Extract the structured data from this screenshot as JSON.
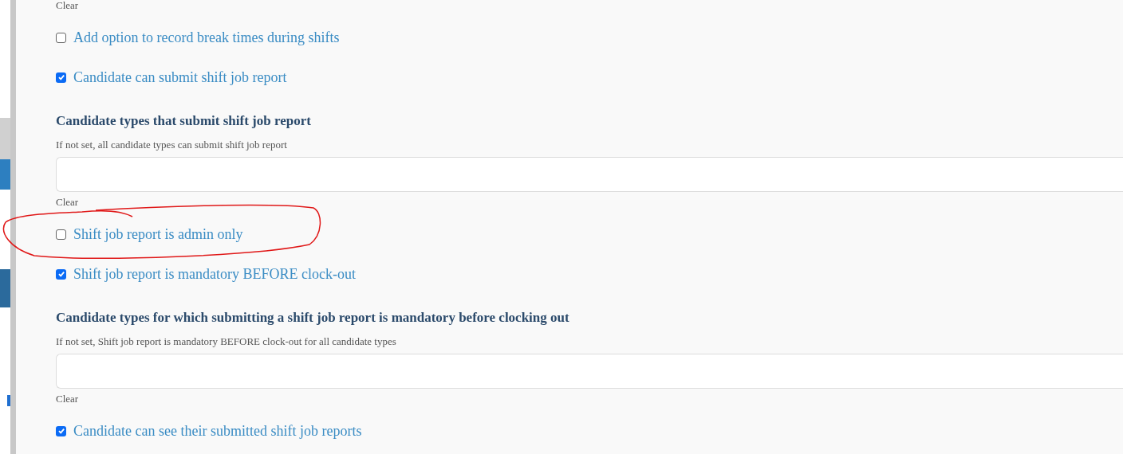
{
  "items": [
    {
      "kind": "clear",
      "label": "Clear"
    },
    {
      "kind": "checkbox",
      "label": "Add option to record break times during shifts",
      "checked": false
    },
    {
      "kind": "checkbox",
      "label": "Candidate can submit shift job report",
      "checked": true
    },
    {
      "kind": "select",
      "heading": "Candidate types that submit shift job report",
      "hint": "If not set, all candidate types can submit shift job report"
    },
    {
      "kind": "clear",
      "label": "Clear"
    },
    {
      "kind": "checkbox",
      "label": "Shift job report is admin only",
      "checked": false
    },
    {
      "kind": "checkbox",
      "label": "Shift job report is mandatory BEFORE clock-out",
      "checked": true
    },
    {
      "kind": "select",
      "heading": "Candidate types for which submitting a shift job report is mandatory before clocking out",
      "hint": "If not set, Shift job report is mandatory BEFORE clock-out for all candidate types"
    },
    {
      "kind": "clear",
      "label": "Clear"
    },
    {
      "kind": "checkbox",
      "label": "Candidate can see their submitted shift job reports",
      "checked": true
    }
  ]
}
